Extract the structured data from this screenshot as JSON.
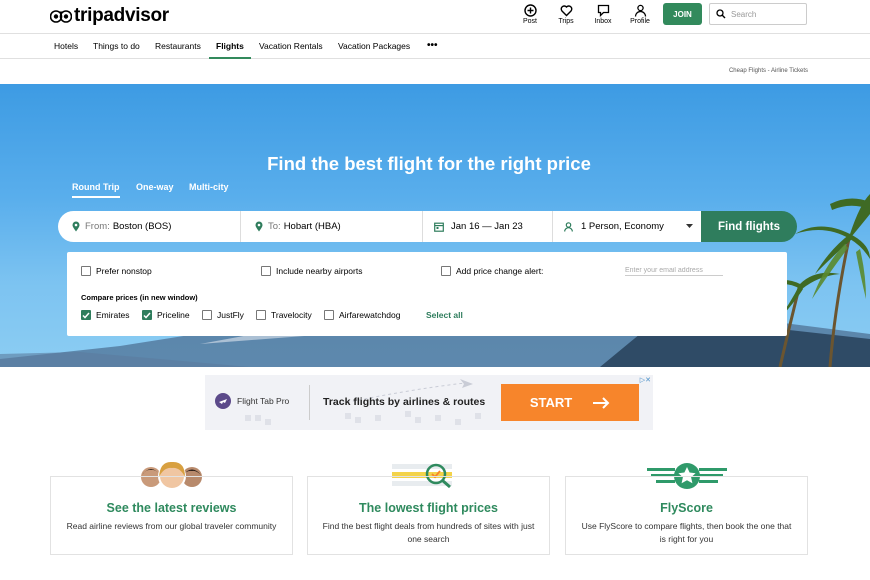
{
  "header": {
    "logo_text": "tripadvisor",
    "actions": [
      {
        "label": "Post",
        "icon": "plus-circle-icon"
      },
      {
        "label": "Trips",
        "icon": "heart-icon"
      },
      {
        "label": "Inbox",
        "icon": "chat-icon"
      },
      {
        "label": "Profile",
        "icon": "person-icon"
      }
    ],
    "join_label": "JOIN",
    "search_placeholder": "Search"
  },
  "nav": {
    "items": [
      "Hotels",
      "Things to do",
      "Restaurants",
      "Flights",
      "Vacation Rentals",
      "Vacation Packages"
    ],
    "active": "Flights",
    "more_label": "•••"
  },
  "breadcrumb": "Cheap Flights - Airline Tickets",
  "hero": {
    "title": "Find the best flight for the right price",
    "trip_tabs": [
      "Round Trip",
      "One-way",
      "Multi-city"
    ],
    "active_tab": "Round Trip",
    "from_label": "From:",
    "from_value": "Boston (BOS)",
    "to_label": "To:",
    "to_value": "Hobart (HBA)",
    "dates": "Jan 16 — Jan 23",
    "travelers": "1 Person, Economy",
    "find_button": "Find flights"
  },
  "options": {
    "prefer_nonstop": {
      "label": "Prefer nonstop",
      "checked": false
    },
    "nearby_airports": {
      "label": "Include nearby airports",
      "checked": false
    },
    "price_alert": {
      "label": "Add price change alert:",
      "checked": false
    },
    "email_placeholder": "Enter your email address",
    "compare_label": "Compare prices (in new window)",
    "providers": [
      {
        "label": "Emirates",
        "checked": true
      },
      {
        "label": "Priceline",
        "checked": true
      },
      {
        "label": "JustFly",
        "checked": false
      },
      {
        "label": "Travelocity",
        "checked": false
      },
      {
        "label": "Airfarewatchdog",
        "checked": false
      }
    ],
    "select_all": "Select all"
  },
  "ad": {
    "brand": "Flight Tab Pro",
    "headline": "Track flights by airlines & routes",
    "cta": "START",
    "close_label": "▷✕"
  },
  "features": [
    {
      "title": "See the latest reviews",
      "desc": "Read airline reviews from our global traveler community"
    },
    {
      "title": "The lowest flight prices",
      "desc": "Find the best flight deals from hundreds of sites with just one search"
    },
    {
      "title": "FlyScore",
      "desc": "Use FlyScore to compare flights, then book the one that is right for you"
    }
  ],
  "colors": {
    "brand_green": "#328a5c",
    "hero_blue": "#59aeec",
    "ad_orange": "#f7852b"
  }
}
